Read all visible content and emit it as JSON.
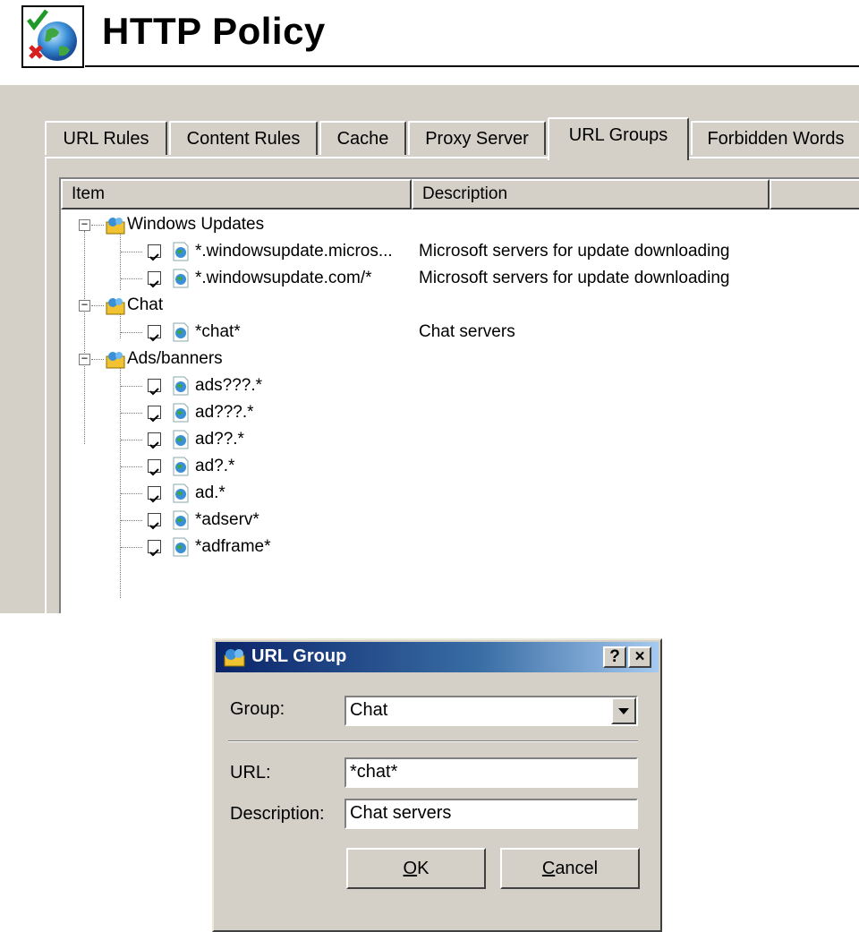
{
  "header": {
    "title": "HTTP Policy",
    "icon": "policy-globe-icon"
  },
  "tabs": [
    {
      "label": "URL Rules",
      "active": false
    },
    {
      "label": "Content Rules",
      "active": false
    },
    {
      "label": "Cache",
      "active": false
    },
    {
      "label": "Proxy Server",
      "active": false
    },
    {
      "label": "URL Groups",
      "active": true
    },
    {
      "label": "Forbidden Words",
      "active": false
    }
  ],
  "list": {
    "columns": [
      "Item",
      "Description",
      ""
    ],
    "groups": [
      {
        "name": "Windows Updates",
        "items": [
          {
            "url": "*.windowsupdate.micros...",
            "checked": true,
            "description": "Microsoft servers for update downloading"
          },
          {
            "url": "*.windowsupdate.com/*",
            "checked": true,
            "description": "Microsoft servers for update downloading"
          }
        ]
      },
      {
        "name": "Chat",
        "items": [
          {
            "url": "*chat*",
            "checked": true,
            "description": "Chat servers"
          }
        ]
      },
      {
        "name": "Ads/banners",
        "items": [
          {
            "url": "ads???.*",
            "checked": true,
            "description": ""
          },
          {
            "url": "ad???.*",
            "checked": true,
            "description": ""
          },
          {
            "url": "ad??.*",
            "checked": true,
            "description": ""
          },
          {
            "url": "ad?.*",
            "checked": true,
            "description": ""
          },
          {
            "url": "ad.*",
            "checked": true,
            "description": ""
          },
          {
            "url": "*adserv*",
            "checked": true,
            "description": ""
          },
          {
            "url": "*adframe*",
            "checked": true,
            "description": ""
          }
        ]
      }
    ]
  },
  "dialog": {
    "title": "URL Group",
    "help_glyph": "?",
    "close_glyph": "×",
    "group_label": "Group:",
    "group_value": "Chat",
    "url_label": "URL:",
    "url_value": "*chat*",
    "description_label": "Description:",
    "description_value": "Chat servers",
    "ok_label": "OK",
    "cancel_label": "Cancel"
  }
}
